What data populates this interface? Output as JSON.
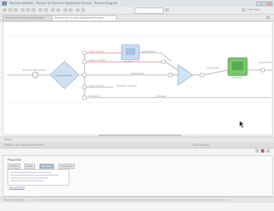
{
  "window": {
    "title": "Business Modeler - Process for the Loan Application Process - Process Diagram",
    "icon": "app-icon"
  },
  "tabs": [
    {
      "label": "Process for the Loan Application",
      "active": false
    },
    {
      "label": "Process for the Loan Application Process",
      "active": true
    }
  ],
  "toolbar": {
    "search_placeholder": "",
    "help_label": "Help Topics"
  },
  "diagram": {
    "start_label": "Receive application",
    "decision_label": "Loan Amount?",
    "task1_label": "Review",
    "task2_label": "Approve",
    "merge_label": "",
    "branch_labels": [
      "Over 10,000",
      "Under 10,000",
      "Over 50,000",
      "Standard"
    ],
    "edge_labels": [
      "Application",
      "Application",
      "Approval request",
      "Application",
      "Application",
      "Decision"
    ]
  },
  "statusbar": {
    "text": "Ready"
  },
  "infobar": {
    "left": "Default: Loan Application Process",
    "right": "Task: Approve"
  },
  "panel": {
    "title": "Properties",
    "tabs": [
      "General",
      "Inputs",
      "Attributes",
      "Description"
    ],
    "active_tab": 2,
    "link_label": "Add attribute"
  },
  "bottombar": {
    "label": "Business Analysis"
  }
}
